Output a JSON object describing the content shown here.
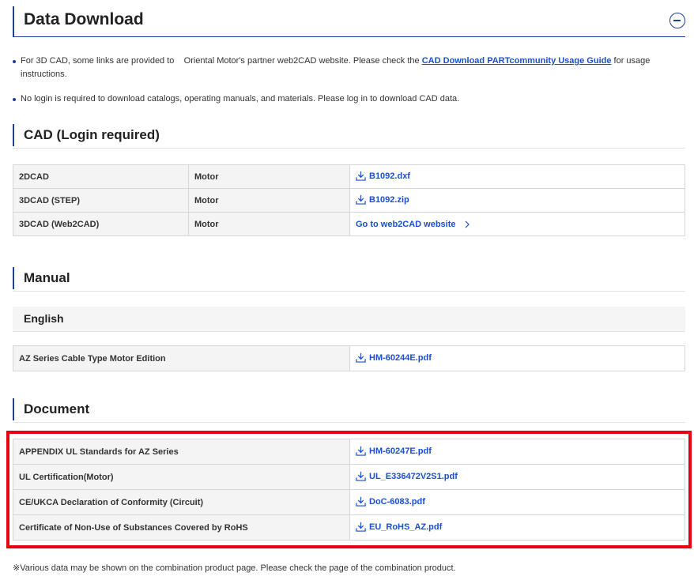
{
  "header": {
    "title": "Data Download",
    "collapse_icon": "minus-circle-icon"
  },
  "notes": [
    {
      "before": "For 3D CAD, some links are provided to    Oriental Motor's partner web2CAD website. Please check the ",
      "link": "CAD Download PARTcommunity Usage Guide",
      "after": " for usage instructions."
    },
    {
      "text": "No login is required to download catalogs, operating manuals, and materials. Please log in to download CAD data."
    }
  ],
  "cad": {
    "title": "CAD (Login required)",
    "rows": [
      {
        "type": "2DCAD",
        "target": "Motor",
        "link": "B1092.dxf",
        "icon": "download-icon"
      },
      {
        "type": "3DCAD (STEP)",
        "target": "Motor",
        "link": "B1092.zip",
        "icon": "download-icon"
      },
      {
        "type": "3DCAD (Web2CAD)",
        "target": "Motor",
        "link": "Go to web2CAD website",
        "icon": "chevron-right-icon"
      }
    ]
  },
  "manual": {
    "title": "Manual",
    "language": "English",
    "rows": [
      {
        "name": "AZ Series Cable Type Motor Edition",
        "link": "HM-60244E.pdf",
        "icon": "download-icon"
      }
    ]
  },
  "document": {
    "title": "Document",
    "rows": [
      {
        "name": "APPENDIX UL Standards for AZ Series",
        "link": "HM-60247E.pdf",
        "icon": "download-icon"
      },
      {
        "name": "UL Certification(Motor)",
        "link": "UL_E336472V2S1.pdf",
        "icon": "download-icon"
      },
      {
        "name": "CE/UKCA Declaration of Conformity (Circuit)",
        "link": "DoC-6083.pdf",
        "icon": "download-icon"
      },
      {
        "name": "Certificate of Non-Use of Substances Covered by RoHS",
        "link": "EU_RoHS_AZ.pdf",
        "icon": "download-icon"
      }
    ]
  },
  "footnote": "※Various data may be shown on the combination product page. Please check the page of the combination product.",
  "colors": {
    "accent": "#1f3d99",
    "link": "#1a4fcf",
    "highlight": "#e60012"
  }
}
